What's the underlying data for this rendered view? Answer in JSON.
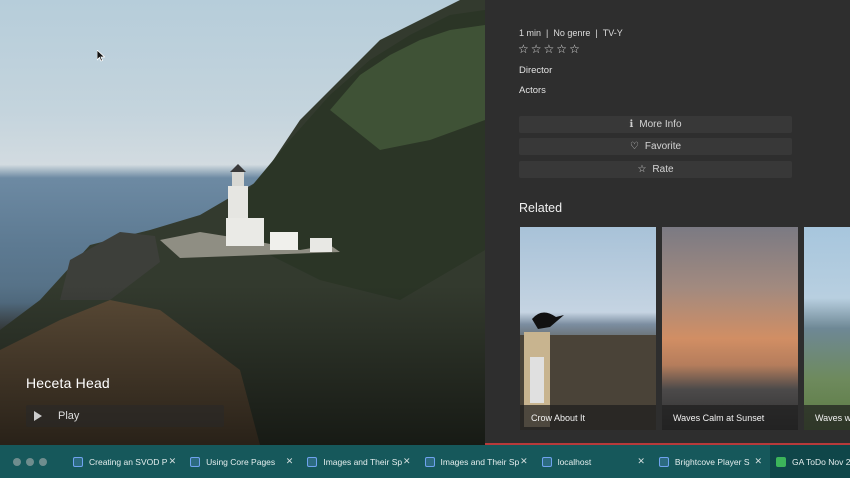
{
  "hero": {
    "title": "Heceta Head",
    "play_label": "Play"
  },
  "details": {
    "duration": "1 min",
    "genre": "No genre",
    "rating": "TV-Y",
    "stars_filled": 0,
    "stars_total": 5,
    "director_label": "Director",
    "actors_label": "Actors"
  },
  "actions": {
    "more_info": "More Info",
    "favorite": "Favorite",
    "rate": "Rate"
  },
  "related": {
    "heading": "Related",
    "items": [
      {
        "title": "Crow About It"
      },
      {
        "title": "Waves Calm at Sunset"
      },
      {
        "title": "Waves w"
      }
    ]
  },
  "browser_tabs": [
    {
      "title": "Creating an SVOD P",
      "icon": "doc-icon"
    },
    {
      "title": "Using Core Pages",
      "icon": "doc-icon"
    },
    {
      "title": "Images and Their Sp",
      "icon": "doc-icon"
    },
    {
      "title": "Images and Their Sp",
      "icon": "doc-icon"
    },
    {
      "title": "localhost",
      "icon": "doc-icon"
    },
    {
      "title": "Brightcove Player S",
      "icon": "doc-icon"
    },
    {
      "title": "GA ToDo Nov 2",
      "icon": "sheet-icon"
    }
  ],
  "colors": {
    "panel": "#2e2e2e",
    "tabbar": "#16585b",
    "button": "#383838"
  }
}
